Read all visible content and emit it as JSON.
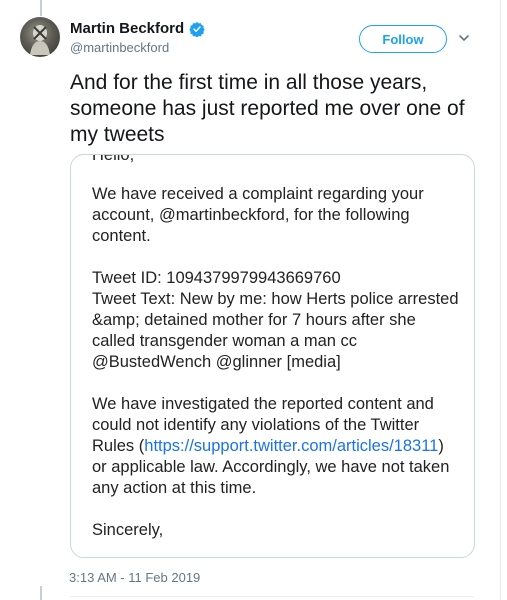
{
  "author": {
    "display_name": "Martin Beckford",
    "handle": "@martinbeckford",
    "verified": true
  },
  "follow_label": "Follow",
  "tweet_text": "And for the first time in all those years, someone has just reported me over one of my tweets",
  "email": {
    "greeting": "Hello,",
    "para1": "We have received a complaint regarding your account, @martinbeckford, for the following content.",
    "tweet_id_line": "Tweet ID: 1094379979943669760",
    "tweet_text_line": "Tweet Text: New by me: how Herts police arrested &amp; detained mother for 7 hours after she called transgender woman a man cc @BustedWench @glinner [media]",
    "para3_before": "We have investigated the reported content and could not identify any violations of the Twitter Rules (",
    "para3_link": "https://support.twitter.com/articles/18311",
    "para3_after": ") or applicable law. Accordingly, we have not taken any action at this time.",
    "closing": "Sincerely,"
  },
  "timestamp": "3:13 AM - 11 Feb 2019",
  "colors": {
    "brand": "#1da1f2",
    "link": "#1a73e8",
    "secondary_text": "#657786"
  }
}
